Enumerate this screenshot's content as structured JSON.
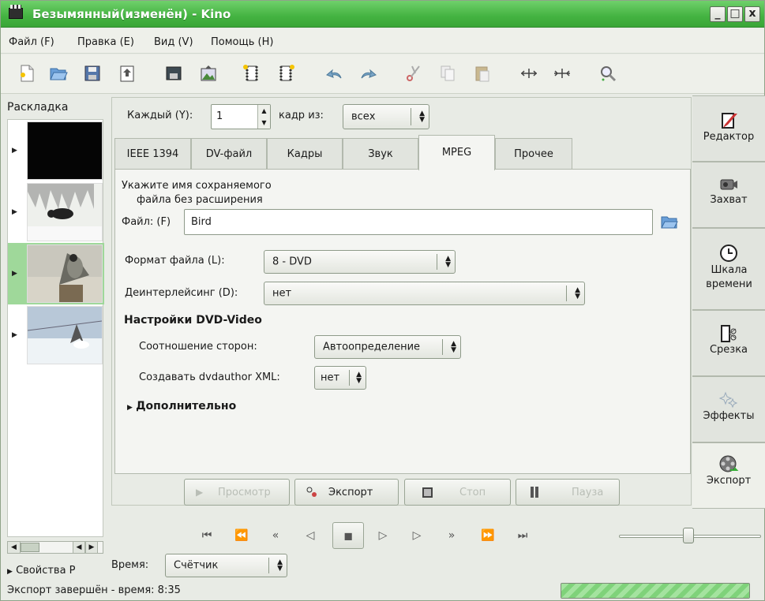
{
  "window": {
    "title": "Безымянный(изменён) - Kino",
    "controls": [
      "_",
      "□",
      "x"
    ]
  },
  "menu": [
    "Файл (F)",
    "Правка (E)",
    "Вид (V)",
    "Помощь (H)"
  ],
  "toolbar_icons": [
    "new-file-icon",
    "open-folder-icon",
    "save-icon",
    "export-icon",
    "save-frame-icon",
    "import-image-icon",
    "insert-before-icon",
    "insert-after-icon",
    "undo-icon",
    "redo-icon",
    "cut-icon",
    "copy-icon",
    "paste-icon",
    "split-icon",
    "join-icon",
    "zoom-icon"
  ],
  "storyboard": {
    "title": "Раскладка",
    "selected_index": 2,
    "thumbnails": [
      "black-frame",
      "animal-in-snow",
      "bird-on-stump",
      "bird-in-snow"
    ]
  },
  "properties_label": "Свойства P",
  "status": {
    "text": "Экспорт завершён - время: 8:35",
    "progress": 1.0
  },
  "time": {
    "label": "Время:",
    "mode": "Счётчик"
  },
  "export": {
    "every_label": "Каждый (Y):",
    "every_value": "1",
    "frames_label": "кадр из:",
    "frames_value": "всех",
    "tabs": [
      "IEEE 1394",
      "DV-файл",
      "Кадры",
      "Звук",
      "MPEG",
      "Прочее"
    ],
    "active_tab": "MPEG",
    "hint_line1": "Укажите имя сохраняемого",
    "hint_line2": "файла без расширения",
    "file_label": "Файл: (F)",
    "file_value": "Bird",
    "format_label": "Формат файла (L):",
    "format_value": "8 - DVD",
    "deinterlace_label": "Деинтерлейсинг (D):",
    "deinterlace_value": "нет",
    "dvd_section": "Настройки DVD-Video",
    "aspect_label": "Соотношение сторон:",
    "aspect_value": "Автоопределение",
    "dvdauthor_label": "Создавать dvdauthor XML:",
    "dvdauthor_value": "нет",
    "advanced": "Дополнительно",
    "buttons": {
      "preview": "Просмотр",
      "export": "Экспорт",
      "stop": "Стоп",
      "pause": "Пауза"
    }
  },
  "right_tabs": [
    {
      "label": "Редактор",
      "icon": "editor-icon"
    },
    {
      "label": "Захват",
      "icon": "capture-icon"
    },
    {
      "label": "Шкала времени",
      "icon": "timeline-icon"
    },
    {
      "label": "Срезка",
      "icon": "trim-icon"
    },
    {
      "label": "Эффекты",
      "icon": "effects-icon"
    },
    {
      "label": "Экспорт",
      "icon": "export-film-icon"
    }
  ],
  "transport": [
    "first-frame",
    "prev-scene",
    "rewind",
    "step-back",
    "stop",
    "play",
    "step-forward",
    "fast-forward",
    "next-scene",
    "last-frame"
  ],
  "colors": {
    "titlebar": "#44b341",
    "selection": "#9fd89a",
    "progress": "#7fd27a"
  }
}
